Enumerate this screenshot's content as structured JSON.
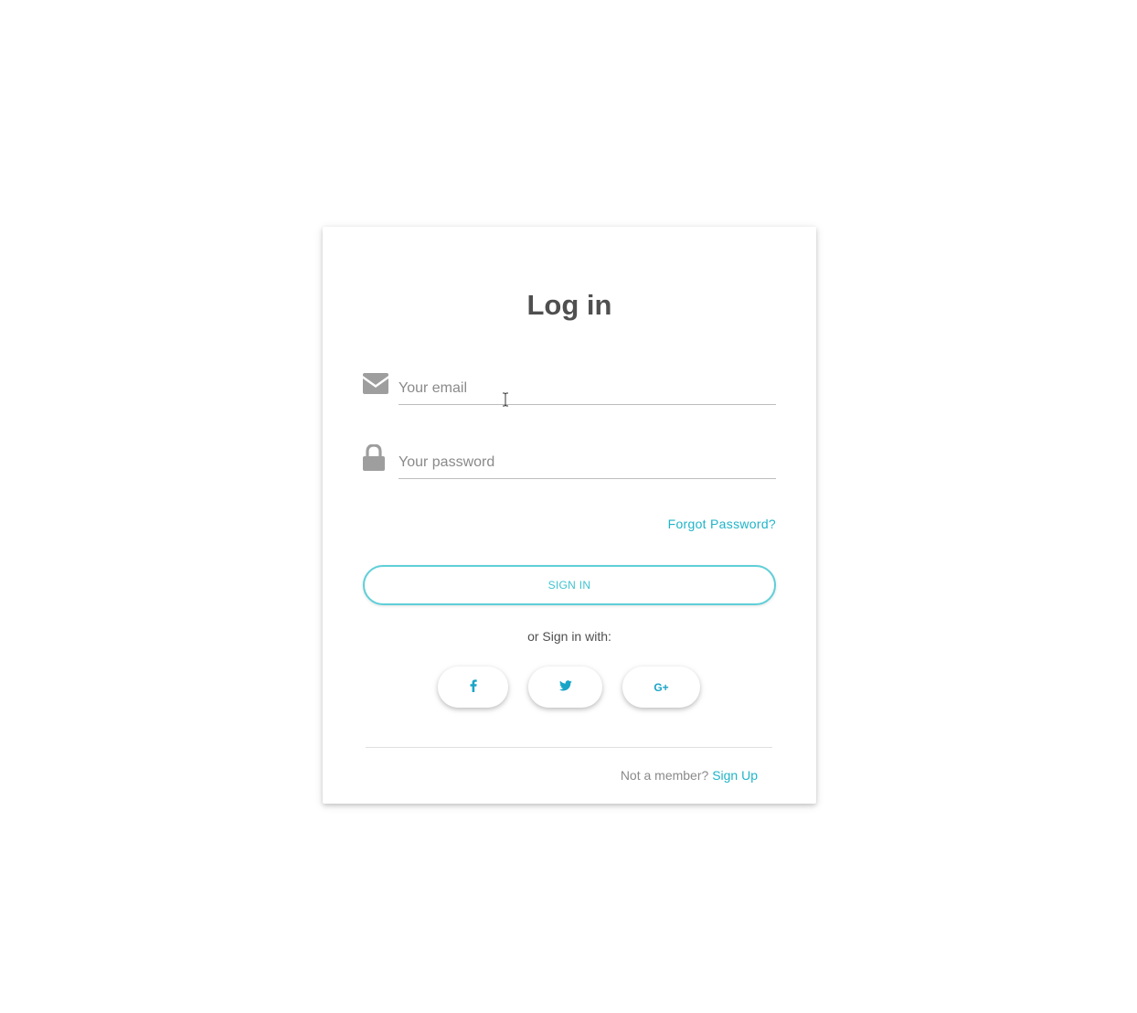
{
  "form": {
    "title": "Log in",
    "email_placeholder": "Your email",
    "email_value": "",
    "password_placeholder": "Your password",
    "password_value": "",
    "forgot_password": "Forgot Password?",
    "sign_in_label": "SIGN IN",
    "or_sign_in_with": "or Sign in with:",
    "social": [
      {
        "icon": "facebook-icon",
        "glyph": "f"
      },
      {
        "icon": "twitter-icon",
        "glyph": ""
      },
      {
        "icon": "google-plus-icon",
        "glyph": "G+"
      }
    ],
    "not_member": "Not a member?",
    "sign_up": "Sign Up"
  },
  "colors": {
    "accent": "#1fb4c9",
    "button_border": "#5fcfd8",
    "icon_gray": "#9e9e9e",
    "title": "#4f4f4f"
  }
}
